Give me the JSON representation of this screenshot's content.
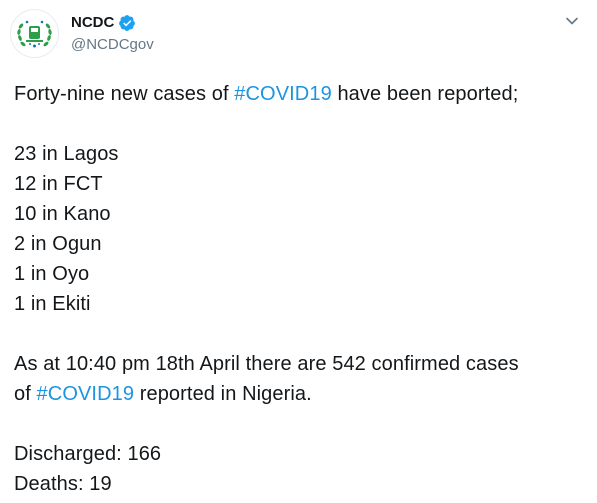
{
  "account": {
    "display_name": "NCDC",
    "handle": "@NCDCgov",
    "verified": true
  },
  "icons": {
    "verified": "verified-badge-icon",
    "menu": "chevron-down-icon",
    "avatar": "ncdc-logo"
  },
  "tweet": {
    "line1_prefix": "Forty-nine new cases of ",
    "line1_hashtag": "#COVID19",
    "line1_suffix": " have been reported;",
    "states": [
      "23 in Lagos",
      "12 in FCT",
      "10 in Kano",
      "2 in Ogun",
      "1 in Oyo",
      "1 in Ekiti"
    ],
    "summary_line1": "As at 10:40 pm 18th April there are 542 confirmed cases",
    "summary_line2_prefix": "of ",
    "summary_line2_hashtag": "#COVID19",
    "summary_line2_suffix": " reported in Nigeria.",
    "discharged": "Discharged: 166",
    "deaths": "Deaths: 19"
  },
  "colors": {
    "text": "#14171a",
    "secondary": "#657786",
    "link": "#1b95e0",
    "verified": "#1da1f2"
  }
}
